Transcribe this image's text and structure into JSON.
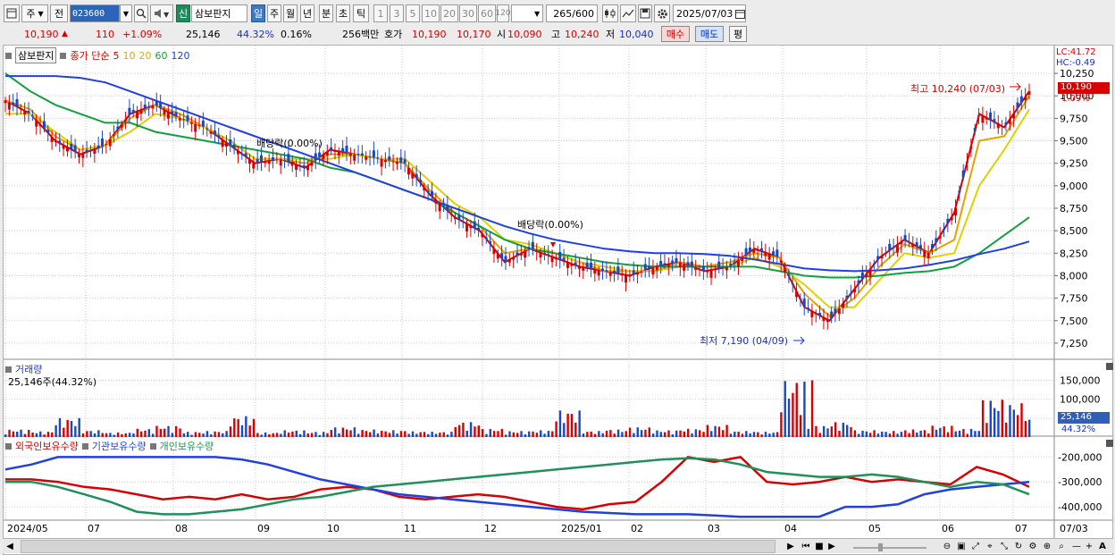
{
  "toolbar": {
    "period_main": "주",
    "prefix": "전",
    "stock_code": "023600",
    "badge_new": "신",
    "stock_name": "삼보판지",
    "periods": [
      "일",
      "주",
      "월",
      "년",
      "분",
      "초",
      "틱"
    ],
    "active_period": "일",
    "counts": [
      "1",
      "3",
      "5",
      "10",
      "20",
      "30",
      "60",
      "120"
    ],
    "range": "265",
    "range_total": "/600",
    "date": "2025/07/03"
  },
  "quote": {
    "price": "10,190",
    "arrow": "▲",
    "change": "110",
    "change_pct": "+1.09%",
    "volume": "25,146",
    "vol_ratio": "44.32%",
    "turnover": "0.16%",
    "amount": "256백만",
    "bid_label": "호가",
    "bid1": "10,190",
    "bid2": "10,170",
    "open_label": "시",
    "open": "10,090",
    "high_label": "고",
    "high": "10,240",
    "low_label": "저",
    "low": "10,040",
    "buy_btn": "매수",
    "sell_btn": "매도",
    "flat_btn": "평"
  },
  "price_panel": {
    "name": "삼보판지",
    "ma_title": "종가 단순",
    "ma_periods": [
      "5",
      "10",
      "20",
      "60",
      "120"
    ],
    "ma_colors": [
      "#d80000",
      "#e8a000",
      "#e0d000",
      "#10a040",
      "#2040e0"
    ],
    "lc": "LC:41.72",
    "hc": "HC:-0.49",
    "current_price": "10,190",
    "current_pct": "1.09%",
    "high_note": "최고 10,240 (07/03)",
    "low_note": "최저 7,190 (04/09)",
    "div_note1": "배당락(0.00%)",
    "div_note2": "배당락(0.00%)",
    "y_ticks": [
      "10,250",
      "10,000",
      "9,750",
      "9,500",
      "9,250",
      "9,000",
      "8,750",
      "8,500",
      "8,250",
      "8,000",
      "7,750",
      "7,500",
      "7,250"
    ]
  },
  "volume_panel": {
    "title": "거래량",
    "summary": "25,146주(44.32%)",
    "y_ticks": [
      "150,000",
      "100,000",
      "50,000"
    ],
    "current": "25,146",
    "current_pct": "44.32%"
  },
  "holding_panel": {
    "series": [
      "외국인보유수량",
      "기관보유수량",
      "개인보유수량"
    ],
    "series_colors": [
      "#d80000",
      "#2040e0",
      "#20905a"
    ],
    "y_ticks": [
      "-200,000",
      "-300,000",
      "-400,000"
    ]
  },
  "x_axis": {
    "labels": [
      "2024/05",
      "07",
      "08",
      "09",
      "10",
      "11",
      "12",
      "2025/01",
      "02",
      "03",
      "04",
      "05",
      "06",
      "07"
    ],
    "right_label": "07/03"
  },
  "chart_data": {
    "type": "line",
    "ma_series": [
      {
        "name": "5",
        "values": [
          9950,
          9800,
          9500,
          9350,
          9450,
          9800,
          9900,
          9750,
          9650,
          9450,
          9250,
          9300,
          9200,
          9400,
          9350,
          9300,
          9250,
          8900,
          8650,
          8500,
          8150,
          8300,
          8200,
          8100,
          8050,
          8000,
          8100,
          8150,
          8050,
          8100,
          8300,
          8200,
          7650,
          7500,
          7850,
          8200,
          8400,
          8250,
          8700,
          9800,
          9650,
          10050
        ]
      },
      {
        "name": "10",
        "values": [
          9950,
          9850,
          9550,
          9400,
          9450,
          9750,
          9900,
          9800,
          9650,
          9500,
          9300,
          9300,
          9250,
          9350,
          9350,
          9300,
          9250,
          8950,
          8700,
          8550,
          8250,
          8300,
          8250,
          8150,
          8050,
          8050,
          8050,
          8150,
          8100,
          8150,
          8250,
          8200,
          7800,
          7550,
          7750,
          8100,
          8350,
          8250,
          8400,
          9500,
          9550,
          10000
        ]
      },
      {
        "name": "20",
        "values": [
          9800,
          9800,
          9600,
          9400,
          9450,
          9600,
          9800,
          9750,
          9650,
          9500,
          9300,
          9300,
          9300,
          9300,
          9350,
          9300,
          9300,
          9050,
          8800,
          8650,
          8400,
          8350,
          8250,
          8150,
          8100,
          8050,
          8050,
          8100,
          8100,
          8100,
          8200,
          8100,
          7900,
          7650,
          7650,
          7950,
          8250,
          8200,
          8250,
          9000,
          9400,
          9850
        ]
      },
      {
        "name": "60",
        "values": [
          10250,
          10050,
          9900,
          9800,
          9700,
          9700,
          9600,
          9550,
          9500,
          9450,
          9400,
          9350,
          9300,
          9200,
          9150,
          9050,
          8950,
          8850,
          8700,
          8550,
          8400,
          8300,
          8250,
          8200,
          8150,
          8120,
          8100,
          8100,
          8100,
          8100,
          8100,
          8050,
          8000,
          7980,
          7980,
          8000,
          8030,
          8050,
          8100,
          8250,
          8450,
          8650
        ]
      },
      {
        "name": "120",
        "values": [
          10220,
          10220,
          10220,
          10200,
          10150,
          10050,
          9950,
          9850,
          9750,
          9650,
          9550,
          9450,
          9350,
          9250,
          9150,
          9050,
          8950,
          8850,
          8750,
          8650,
          8550,
          8470,
          8400,
          8350,
          8300,
          8270,
          8250,
          8250,
          8240,
          8220,
          8180,
          8130,
          8080,
          8060,
          8050,
          8060,
          8080,
          8120,
          8170,
          8240,
          8300,
          8380
        ]
      }
    ],
    "y_range": [
      7100,
      10400
    ],
    "volume_values": [
      20,
      15,
      50,
      18,
      12,
      22,
      30,
      14,
      16,
      55,
      12,
      18,
      14,
      26,
      20,
      18,
      15,
      14,
      40,
      22,
      16,
      18,
      70,
      16,
      20,
      26,
      18,
      22,
      32,
      16,
      14,
      150,
      30,
      40,
      18,
      16,
      20,
      30,
      22,
      100,
      90,
      50
    ],
    "volume_range": [
      0,
      170000
    ],
    "holdings": [
      {
        "name": "외국인보유수량",
        "values": [
          -290,
          -290,
          -300,
          -320,
          -330,
          -350,
          -370,
          -360,
          -370,
          -350,
          -370,
          -360,
          -330,
          -320,
          -330,
          -360,
          -370,
          -360,
          -350,
          -360,
          -380,
          -400,
          -410,
          -390,
          -380,
          -300,
          -200,
          -220,
          -200,
          -300,
          -310,
          -300,
          -280,
          -300,
          -290,
          -300,
          -310,
          -240,
          -270,
          -320
        ]
      },
      {
        "name": "기관보유수량",
        "values": [
          -250,
          -230,
          -200,
          -200,
          -200,
          -200,
          -200,
          -200,
          -200,
          -210,
          -230,
          -260,
          -290,
          -310,
          -330,
          -350,
          -360,
          -370,
          -380,
          -390,
          -400,
          -410,
          -420,
          -425,
          -430,
          -430,
          -430,
          -435,
          -440,
          -440,
          -440,
          -440,
          -400,
          -400,
          -390,
          -350,
          -330,
          -320,
          -310,
          -300
        ]
      },
      {
        "name": "개인보유수량",
        "values": [
          -300,
          -300,
          -320,
          -350,
          -380,
          -420,
          -430,
          -430,
          -420,
          -410,
          -390,
          -370,
          -360,
          -340,
          -320,
          -310,
          -300,
          -290,
          -280,
          -270,
          -260,
          -250,
          -240,
          -230,
          -220,
          -210,
          -205,
          -210,
          -230,
          -260,
          -270,
          -280,
          -280,
          -270,
          -280,
          -300,
          -320,
          -300,
          -310,
          -350
        ]
      }
    ],
    "holding_range": [
      -450,
      -170
    ]
  }
}
